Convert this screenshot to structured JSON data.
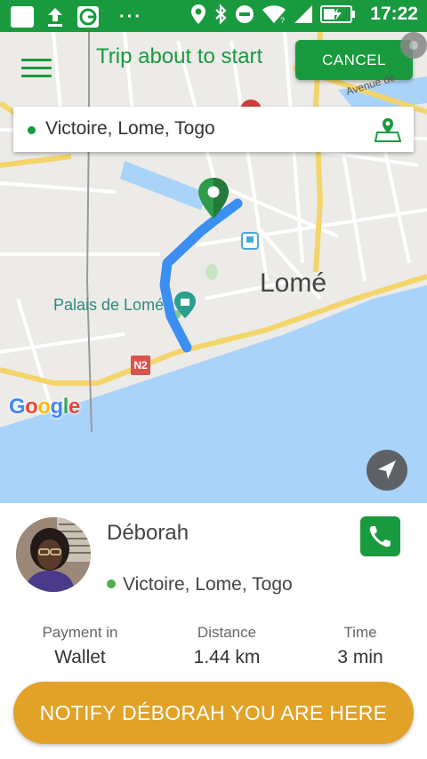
{
  "status_bar": {
    "time": "17:22",
    "more_glyph": "···",
    "icons": [
      "notification-square-icon",
      "upload-icon",
      "app-icon",
      "more-icon",
      "location-icon",
      "bluetooth-icon",
      "do-not-disturb-icon",
      "wifi-icon",
      "signal-icon",
      "battery-charging-icon"
    ]
  },
  "header": {
    "title": "Trip about to start",
    "cancel_label": "CANCEL"
  },
  "search": {
    "value": "Victoire, Lome, Togo"
  },
  "map": {
    "city_label": "Lomé",
    "poi_label": "Palais de Lomé",
    "street_label": "Avenue de",
    "road_badge": "N2",
    "attribution": "Google",
    "colors": {
      "route": "#3b8ff0",
      "water": "#aad3f9",
      "road": "#f4d56b",
      "pin": "#2e9c4a"
    }
  },
  "driver": {
    "name": "Déborah",
    "location": "Victoire, Lome, Togo"
  },
  "stats": [
    {
      "label": "Payment in",
      "value": "Wallet"
    },
    {
      "label": "Distance",
      "value": "1.44 km"
    },
    {
      "label": "Time",
      "value": "3 min"
    }
  ],
  "notify_label": "NOTIFY DÉBORAH YOU ARE HERE",
  "colors": {
    "brand_green": "#1a9a3f",
    "accent_orange": "#e2a228"
  }
}
